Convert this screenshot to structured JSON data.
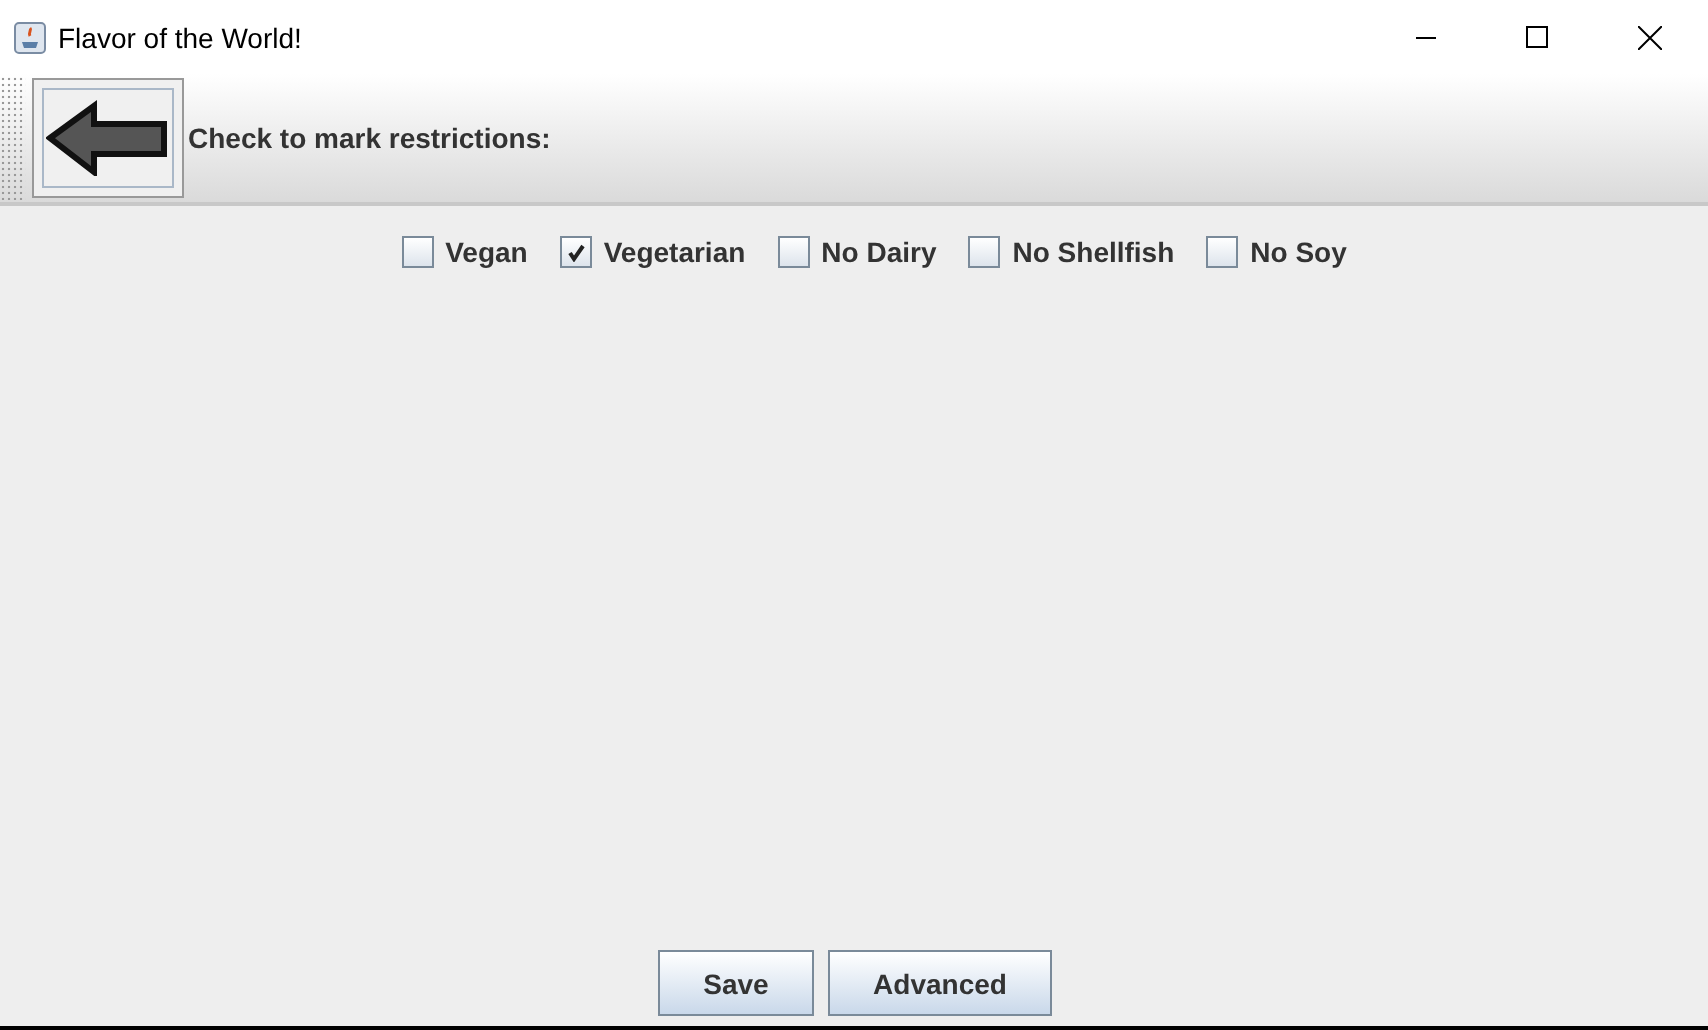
{
  "window": {
    "title": "Flavor of the World!"
  },
  "toolbar": {
    "label": "Check to mark restrictions:"
  },
  "restrictions": [
    {
      "label": "Vegan",
      "checked": false
    },
    {
      "label": "Vegetarian",
      "checked": true
    },
    {
      "label": "No Dairy",
      "checked": false
    },
    {
      "label": "No Shellfish",
      "checked": false
    },
    {
      "label": "No Soy",
      "checked": false
    }
  ],
  "buttons": [
    "Save",
    "Advanced"
  ]
}
